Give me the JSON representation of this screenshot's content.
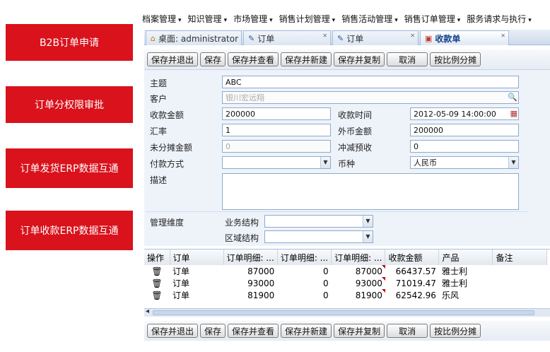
{
  "promos": [
    "B2B订单申请",
    "订单分权限审批",
    "订单发货ERP数据互通",
    "订单收款ERP数据互通"
  ],
  "menu": [
    "档案管理",
    "知识管理",
    "市场管理",
    "销售计划管理",
    "销售活动管理",
    "销售订单管理",
    "服务请求与执行"
  ],
  "tabs": [
    {
      "label": "桌面: administrator",
      "icon": "home-icon"
    },
    {
      "label": "订单",
      "icon": "pencil-icon"
    },
    {
      "label": "订单",
      "icon": "pencil-icon"
    },
    {
      "label": "收款单",
      "icon": "receipt-icon"
    }
  ],
  "toolbar": [
    "保存并退出",
    "保存",
    "保存并查看",
    "保存并新建",
    "保存并复制",
    "取消",
    "按比例分摊"
  ],
  "form": {
    "subject_label": "主题",
    "subject_value": "ABC",
    "customer_label": "客户",
    "customer_value": "银川宏远翔",
    "amount_label": "收款金额",
    "amount_value": "200000",
    "time_label": "收款时间",
    "time_value": "2012-05-09 14:00:00",
    "rate_label": "汇率",
    "rate_value": "1",
    "foreign_label": "外币金额",
    "foreign_value": "200000",
    "unalloc_label": "未分摊金额",
    "unalloc_value": "0",
    "offset_label": "冲减预收",
    "offset_value": "0",
    "paymethod_label": "付款方式",
    "paymethod_value": "",
    "currency_label": "币种",
    "currency_value": "人民币",
    "desc_label": "描述",
    "dim_label": "管理维度",
    "biz_label": "业务结构",
    "region_label": "区域结构"
  },
  "grid": {
    "columns": [
      "操作",
      "订单",
      "订单明细: ...",
      "订单明细: ...",
      "订单明细: ...",
      "收款金额",
      "产品",
      "备注"
    ],
    "rows": [
      [
        "",
        "订单",
        "87000",
        "0",
        "87000",
        "66437.57",
        "雅士利",
        ""
      ],
      [
        "",
        "订单",
        "93000",
        "0",
        "93000",
        "71019.47",
        "雅士利",
        ""
      ],
      [
        "",
        "订单",
        "81900",
        "0",
        "81900",
        "62542.96",
        "乐风",
        ""
      ]
    ]
  }
}
